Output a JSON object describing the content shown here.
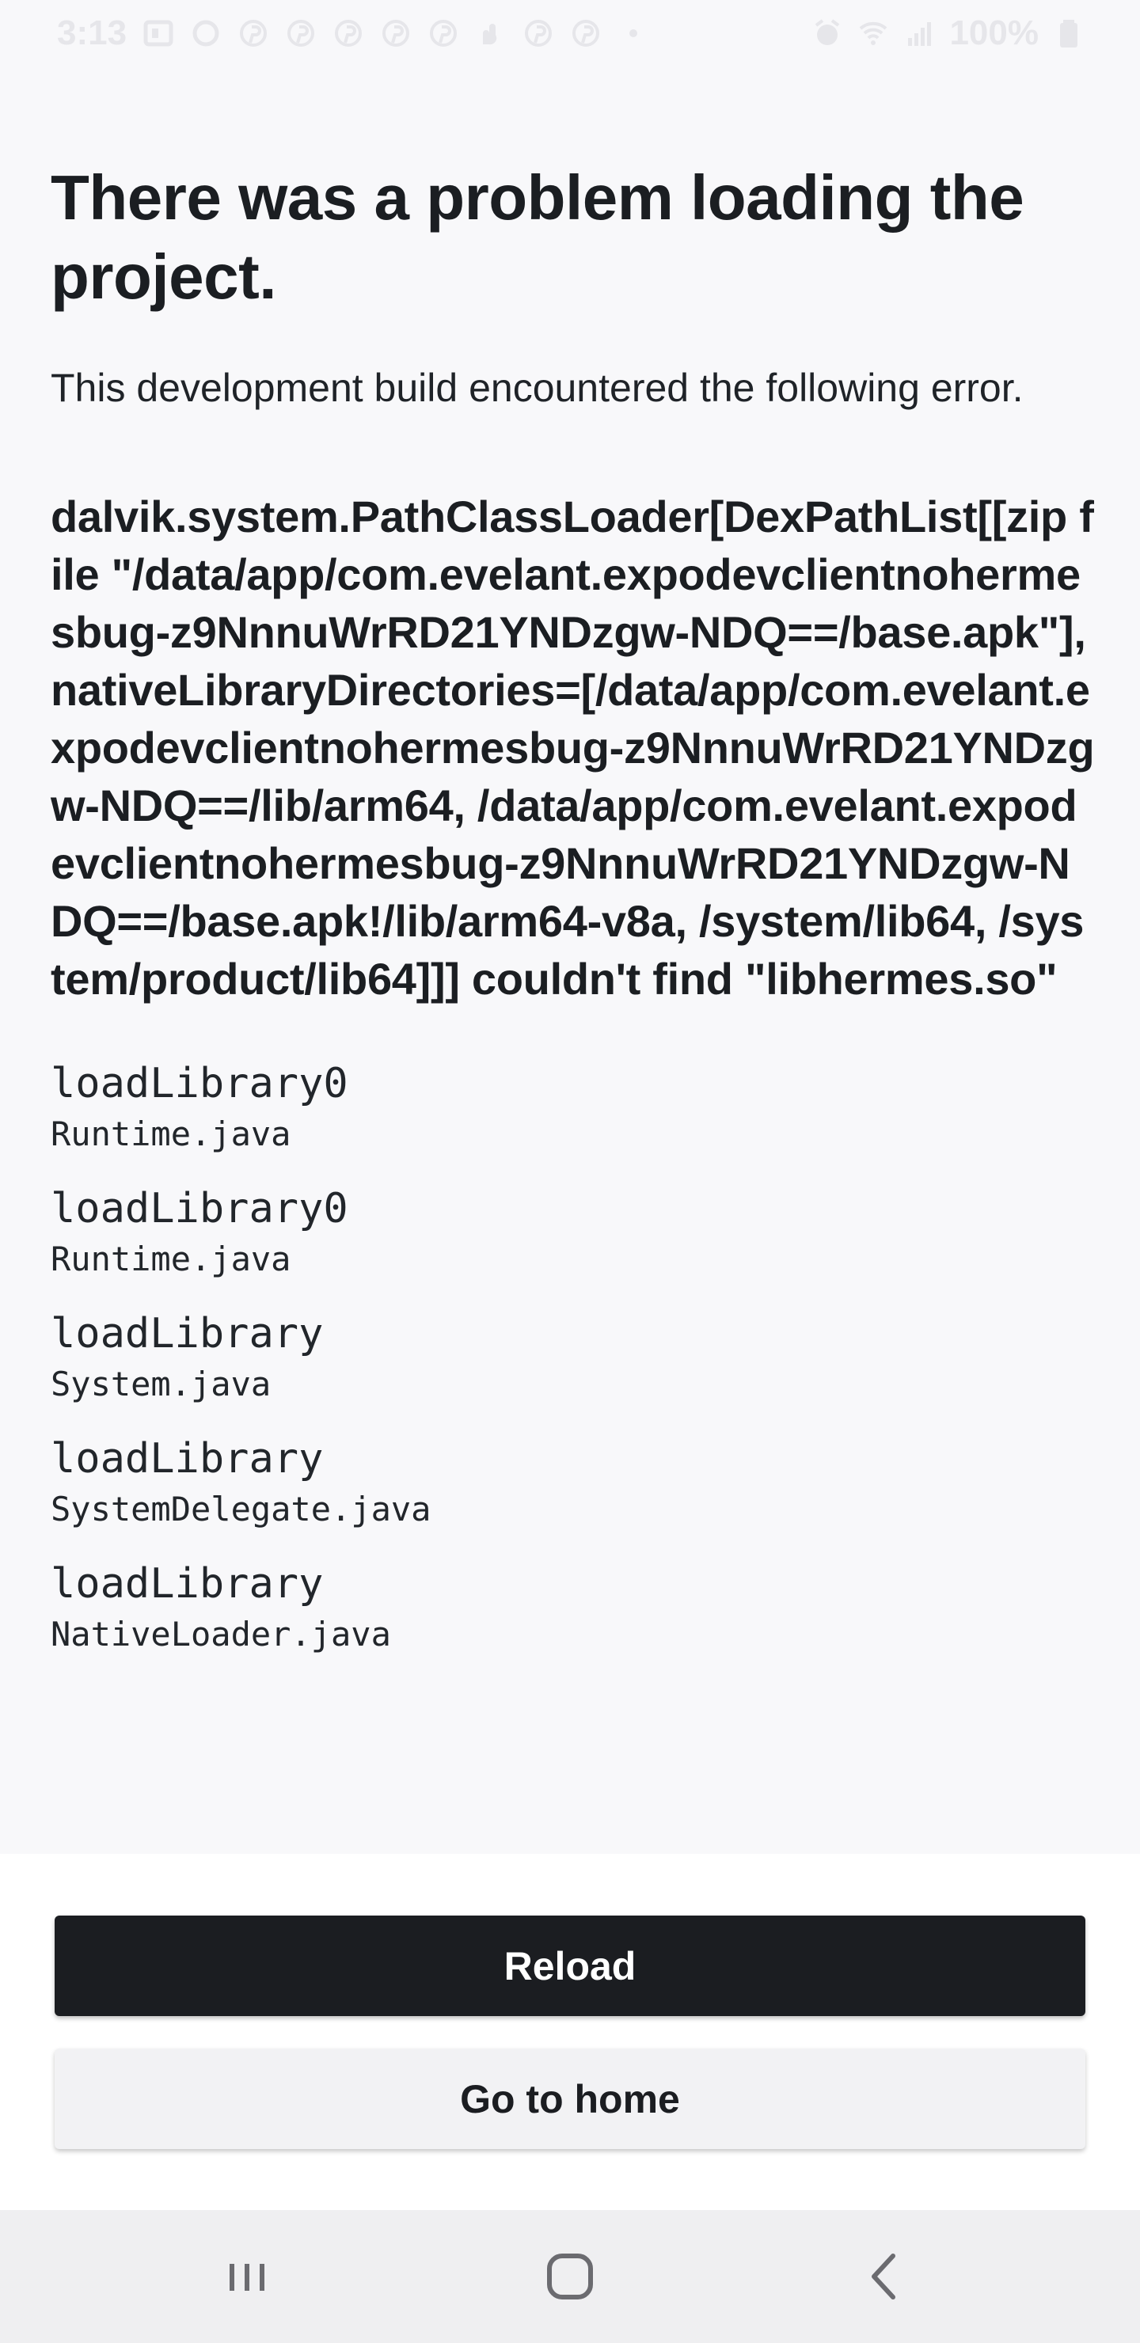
{
  "status_bar": {
    "time": "3:13",
    "battery": "100%",
    "icons": [
      "notification-icon",
      "circle-icon",
      "pinterest-icon",
      "pinterest-icon",
      "pinterest-icon",
      "pinterest-icon",
      "pinterest-icon",
      "gesture-icon",
      "pinterest-icon",
      "pinterest-icon",
      "dot-icon",
      "alarm-icon",
      "wifi-icon",
      "signal-icon",
      "battery-icon"
    ]
  },
  "error_screen": {
    "title": "There was a problem loading the project.",
    "subtitle": "This development build encountered the following error.",
    "error_message": "dalvik.system.PathClassLoader[DexPathList[[zip file \"/data/app/com.evelant.expodevclientnohermesbug-z9NnnuWrRD21YNDzgw-NDQ==/base.apk\"],nativeLibraryDirectories=[/data/app/com.evelant.expodevclientnohermesbug-z9NnnuWrRD21YNDzgw-NDQ==/lib/arm64, /data/app/com.evelant.expodevclientnohermesbug-z9NnnuWrRD21YNDzgw-NDQ==/base.apk!/lib/arm64-v8a, /system/lib64, /system/product/lib64]]] couldn't find \"libhermes.so\"",
    "stack": [
      {
        "method": "loadLibrary0",
        "file": "Runtime.java"
      },
      {
        "method": "loadLibrary0",
        "file": "Runtime.java"
      },
      {
        "method": "loadLibrary",
        "file": "System.java"
      },
      {
        "method": "loadLibrary",
        "file": "SystemDelegate.java"
      },
      {
        "method": "loadLibrary",
        "file": "NativeLoader.java"
      }
    ]
  },
  "actions": {
    "reload_label": "Reload",
    "home_label": "Go to home"
  },
  "nav_bar": {
    "icons": [
      "recent-apps-icon",
      "home-icon",
      "back-icon"
    ]
  },
  "colors": {
    "background": "#f8f8fa",
    "primary_button": "#1b1d21",
    "secondary_button": "#f2f2f4",
    "nav_bar": "#efeff1"
  }
}
